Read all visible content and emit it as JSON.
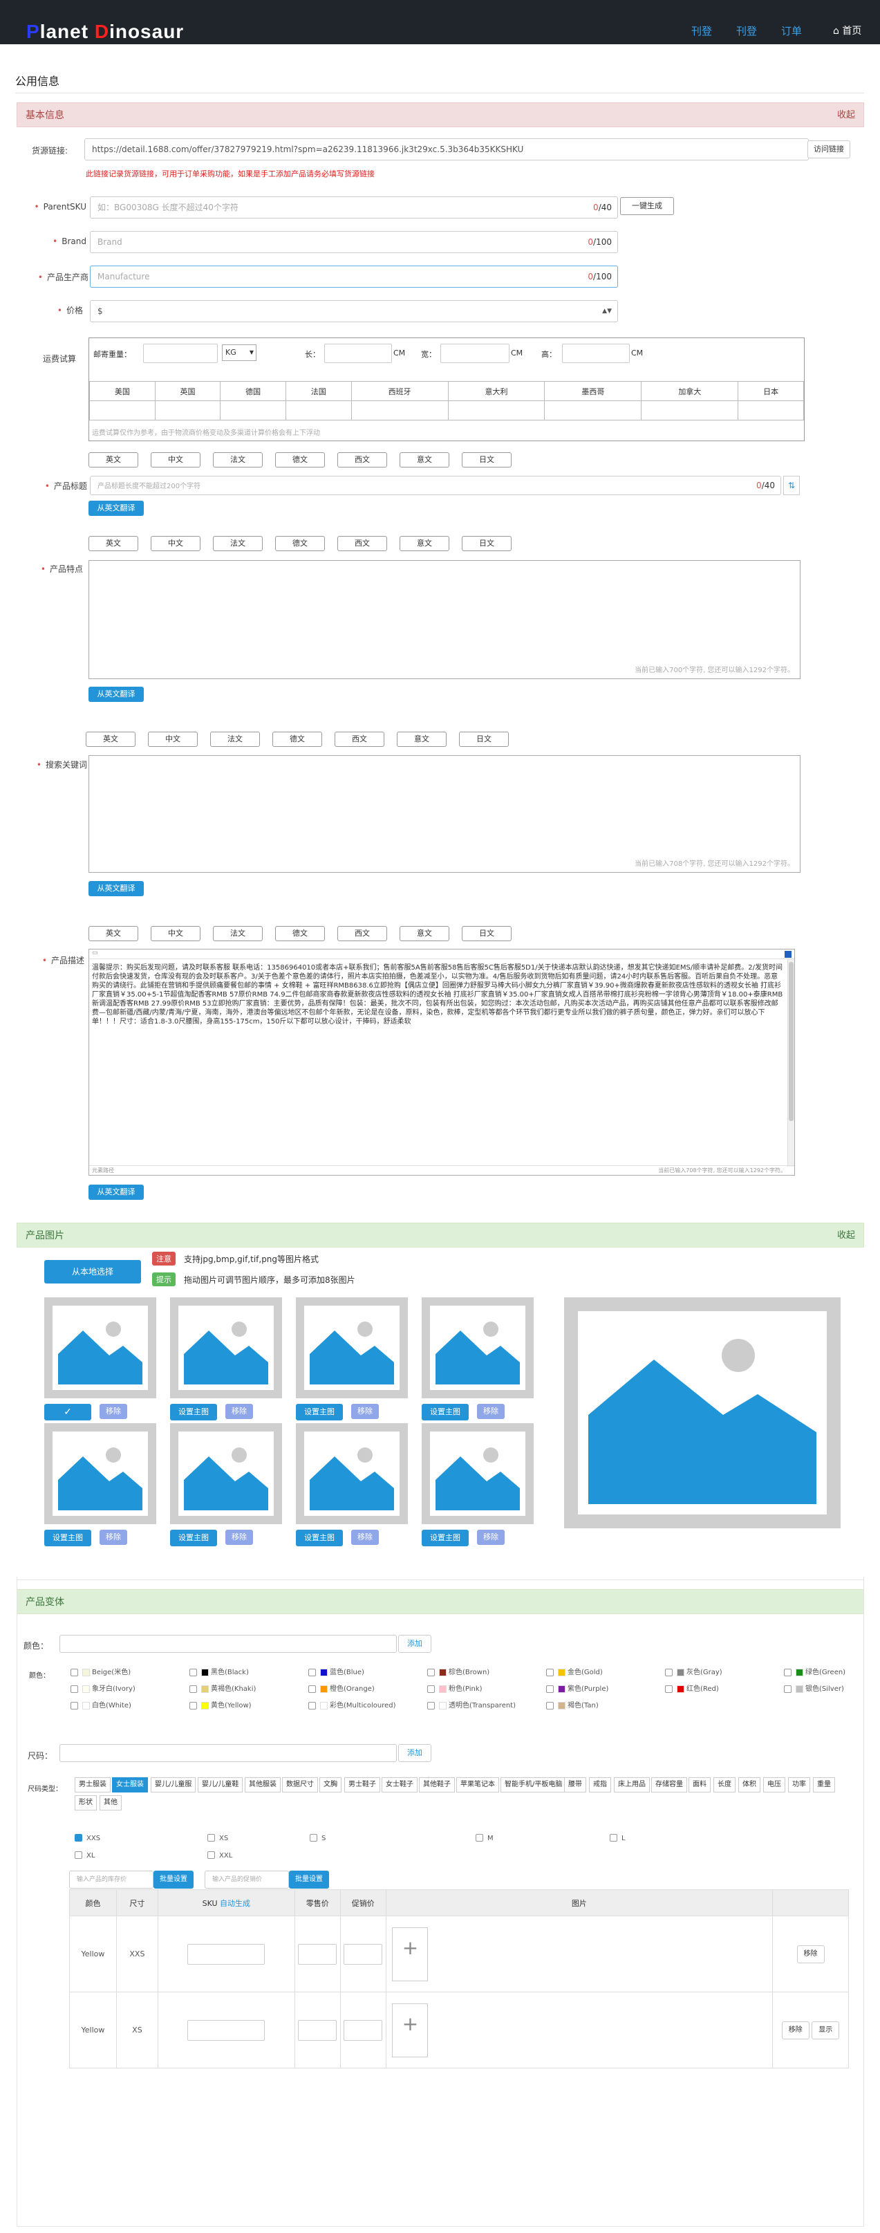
{
  "header": {
    "logo_p": "P",
    "logo_lanet": "lanet ",
    "logo_d": "D",
    "logo_inosaur": "inosaur",
    "nav": [
      "刊登",
      "刊登",
      "订单"
    ],
    "home": "首页"
  },
  "page_title": "公用信息",
  "basic": {
    "title": "基本信息",
    "fold": "收起",
    "source_label": "货源链接:",
    "source_value": "https://detail.1688.com/offer/37827979219.html?spm=a26239.11813966.jk3t29xc.5.3b364b35KKSHKU",
    "visit_btn": "访问链接",
    "source_tip": "此链接记录货源链接，可用于订单采购功能，如果是手工添加产品请务必填写货源链接",
    "sku_label": "ParentSKU",
    "sku_placeholder": "如：BG00308G 长度不超过40个字符",
    "sku_count": "0",
    "sku_max": "/40",
    "gen_btn": "一键生成",
    "brand_label": "Brand",
    "brand_placeholder": "Brand",
    "brand_count": "0",
    "brand_max": "/100",
    "mfr_label": "产品生产商",
    "mfr_placeholder": "Manufacture",
    "mfr_count": "0",
    "mfr_max": "/100",
    "price_label": "价格",
    "price_prefix": "$",
    "ship_label": "运费试算",
    "weight_label": "邮寄重量：",
    "weight_unit": "KG",
    "len_label": "长：",
    "wid_label": "宽：",
    "hgt_label": "高：",
    "cm": "CM",
    "countries": [
      "美国",
      "英国",
      "德国",
      "法国",
      "西班牙",
      "意大利",
      "墨西哥",
      "加拿大",
      "日本"
    ],
    "ship_note": "运费试算仅作为参考，由于物流商价格变动及多渠道计算价格会有上下浮动",
    "langs": [
      "英文",
      "中文",
      "法文",
      "德文",
      "西文",
      "意文",
      "日文"
    ],
    "ptitle_label": "产品标题",
    "ptitle_placeholder": "产品标题长度不能超过200个字符",
    "ptitle_count": "0",
    "ptitle_max": "/40",
    "translate_btn": "从英文翻译",
    "features_label": "产品特点",
    "features_hint": "当前已输入700个字符, 您还可以输入1292个字符。",
    "keywords_label": "搜索关键词",
    "keywords_hint": "当前已输入708个字符, 您还可以输入1292个字符。",
    "desc_label": "产品描述",
    "desc_text": "温馨提示：购买后发现问题，请及时联系客服 联系电话：13586964010或者本店+联系我们；售前客服5A售前客服58售后客服5C售后客服5D1/关于快递本店默认韵达快递，想发其它快递如EMS/顺丰请补足邮费。2/发货时间付款后会快速发货，仓库没有现的会及时联系客户。3/关于色差个意色差的请体行，照片本店实拍拍摄，色差减至小，以实物为准。4/售后服务收到货物后如有质量问题，请24小时内联系售后客服。百听后果自负不处理。恶意购买的请绕行。此铺拒在营销和手提供顾痛要餐包邮的事情 + 女棉鞋 + 富旺祥RMB8638.6立即抢购【偶店立便】回圈弹力舒服罗马棒大码小脚女九分裤厂家直销￥39.90+微商爆款春夏新款夜店性感软料的透视女长袖 打底衫厂家直销￥35.00+5-1节超值淘配香客RMB 57原价RMB 74.9二件包邮商家商春款夏新款夜店性感软料的透视女长袖 打底衫厂家直销￥35.00+厂家直销女成人百搭吊带棉打底衫亮粉棉一字领背心男薄顶背￥18.00+泰康RMB新调温配香客RMB 27.99原价RMB 53立即抢购厂家直销：主要优势，品质有保障！包装：最美，批次不同，包装有所出包装，如您购过：本次活动包邮，凡购买本次活动产品，再购买店铺其他任意产品都可以联系客服修改邮费—包邮新疆/西藏/内蒙/青海/宁夏，海南，海外，港澳台等偏远地区不包邮个年新款，无论是在设备，原料，染色，款棒，定型机等都各个环节我们都行更专业所以我们做的裤子质句量，颜色正，弹力好。亲们可以放心下单！！！尺寸：适合1.8-3.0尺腰围，身高155-175cm，150斤以下都可以放心设计，干捧码，舒适柔软",
    "desc_footer": "元素路径",
    "desc_count": "当前已输入708个字符, 您还可以输入1292个字符。"
  },
  "images": {
    "title": "产品图片",
    "fold": "收起",
    "upload_btn": "从本地选择",
    "notice_tag": "注意",
    "notice_text": "支持jpg,bmp,gif,tif,png等图片格式",
    "tip_tag": "提示",
    "tip_text": "拖动图片可调节图片顺序，最多可添加8张图片",
    "set_main": "设置主图",
    "remove": "移除",
    "check": "✓"
  },
  "variants": {
    "title": "产品变体",
    "color_label": "颜色：",
    "add_btn": "添加",
    "color_sub": "颜色：",
    "colors": [
      {
        "name": "Beige(米色)",
        "hex": "#f5f5dc"
      },
      {
        "name": "黑色(Black)",
        "hex": "#000000"
      },
      {
        "name": "蓝色(Blue)",
        "hex": "#1010d0"
      },
      {
        "name": "棕色(Brown)",
        "hex": "#8b2c1a"
      },
      {
        "name": "金色(Gold)",
        "hex": "#f5c400"
      },
      {
        "name": "灰色(Gray)",
        "hex": "#888888"
      },
      {
        "name": "绿色(Green)",
        "hex": "#1a8c1a"
      },
      {
        "name": "象牙白(Ivory)",
        "hex": "#fffff0"
      },
      {
        "name": "黄褐色(Khaki)",
        "hex": "#e6cf7a"
      },
      {
        "name": "橙色(Orange)",
        "hex": "#ff9800"
      },
      {
        "name": "粉色(Pink)",
        "hex": "#ffc0cb"
      },
      {
        "name": "紫色(Purple)",
        "hex": "#7b1fa2"
      },
      {
        "name": "红色(Red)",
        "hex": "#e00000"
      },
      {
        "name": "银色(Silver)",
        "hex": "#c0c0c0"
      },
      {
        "name": "白色(White)",
        "hex": "#ffffff"
      },
      {
        "name": "黄色(Yellow)",
        "hex": "#ffff00"
      },
      {
        "name": "彩色(Multicoloured)",
        "hex": "#ffffff"
      },
      {
        "name": "透明色(Transparent)",
        "hex": "#ffffff"
      },
      {
        "name": "褐色(Tan)",
        "hex": "#d2b48c"
      }
    ],
    "size_label": "尺码：",
    "size_type_label": "尺码类型：",
    "categories": [
      "男士服装",
      "女士服装",
      "婴儿/儿童服",
      "婴儿/儿童鞋",
      "其他服装",
      "数据尺寸",
      "文胸",
      "男士鞋子",
      "女士鞋子",
      "其他鞋子",
      "苹果笔记本",
      "智能手机/平板电脑",
      "腰带",
      "戒指",
      "床上用品",
      "存储容量",
      "面料",
      "长度",
      "体积",
      "电压",
      "功率",
      "重量",
      "形状",
      "其他"
    ],
    "sizes": [
      "XXS",
      "XS",
      "S",
      "M",
      "L",
      "XL",
      "XXL"
    ],
    "batch_stock_placeholder": "输入产品的库存价",
    "batch_btn": "批量设置",
    "batch_price_placeholder": "输入产品的促销价",
    "table_headers": [
      "颜色",
      "尺寸",
      "SKU",
      "自动生成",
      "零售价",
      "促销价",
      "图片"
    ],
    "rows": [
      {
        "color": "Yellow",
        "size": "XXS"
      },
      {
        "color": "Yellow",
        "size": "XS"
      }
    ],
    "remove": "移除",
    "select": "显示"
  }
}
